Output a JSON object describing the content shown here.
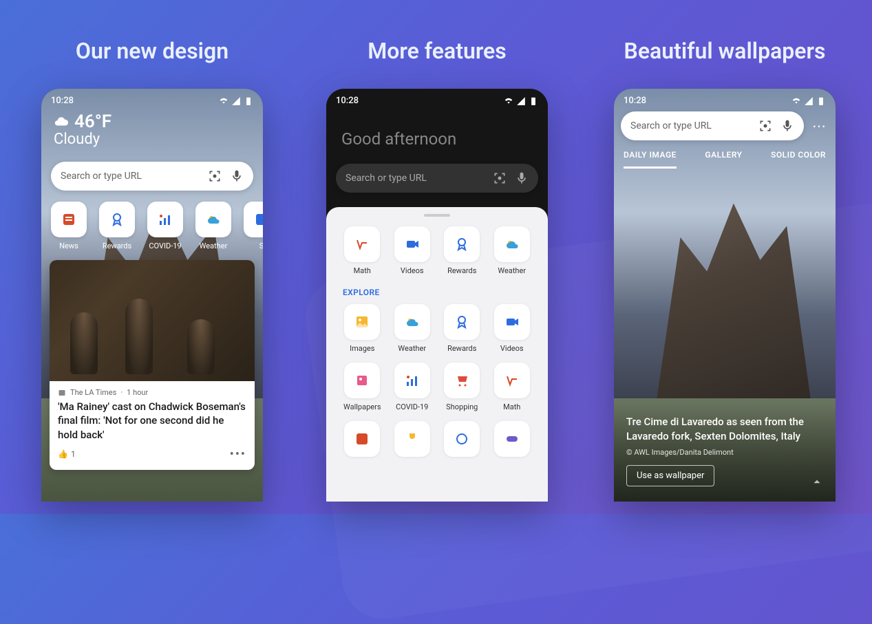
{
  "headings": {
    "panel1": "Our new design",
    "panel2": "More features",
    "panel3": "Beautiful wallpapers"
  },
  "status_time": "10:28",
  "phone1": {
    "temp": "46°F",
    "weather_desc": "Cloudy",
    "search_placeholder": "Search or type URL",
    "tiles": [
      {
        "label": "News"
      },
      {
        "label": "Rewards"
      },
      {
        "label": "COVID-19"
      },
      {
        "label": "Weather"
      },
      {
        "label": "S"
      }
    ],
    "news": {
      "source": "The LA Times",
      "age": "1 hour",
      "title": "'Ma Rainey' cast on Chadwick Boseman's final film: 'Not for one second did he hold back'",
      "react_count": "1"
    }
  },
  "phone2": {
    "greeting": "Good afternoon",
    "search_placeholder": "Search or type URL",
    "row1": [
      {
        "label": "Math"
      },
      {
        "label": "Videos"
      },
      {
        "label": "Rewards"
      },
      {
        "label": "Weather"
      }
    ],
    "explore_label": "EXPLORE",
    "row2": [
      {
        "label": "Images"
      },
      {
        "label": "Weather"
      },
      {
        "label": "Rewards"
      },
      {
        "label": "Videos"
      }
    ],
    "row3": [
      {
        "label": "Wallpapers"
      },
      {
        "label": "COVID-19"
      },
      {
        "label": "Shopping"
      },
      {
        "label": "Math"
      }
    ]
  },
  "phone3": {
    "search_placeholder": "Search or type URL",
    "tabs": {
      "daily": "DAILY IMAGE",
      "gallery": "GALLERY",
      "solid": "SOLID COLOR"
    },
    "caption": "Tre Cime di Lavaredo as seen from the Lavaredo fork, Sexten Dolomites, Italy",
    "credit": "© AWL Images/Danita Delimont",
    "button": "Use as wallpaper"
  }
}
